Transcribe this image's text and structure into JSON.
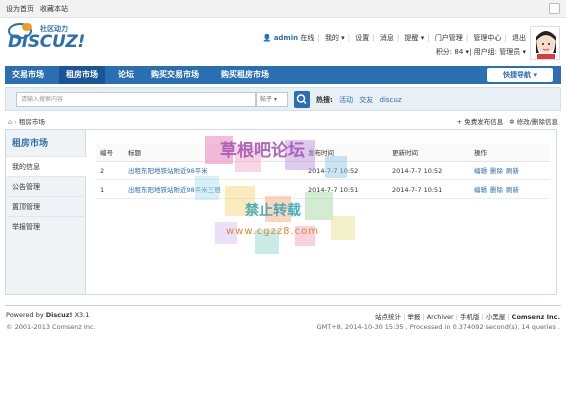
{
  "topbar": {
    "set_home": "设为首页",
    "bookmark": "收藏本站"
  },
  "header": {
    "logo_text": "DISCUZ!",
    "logo_sub": "社区动力",
    "username": "admin",
    "online": "在线",
    "menu": [
      "我的",
      "设置",
      "消息",
      "提醒",
      "门户管理",
      "管理中心",
      "退出"
    ],
    "points": "积分: 84",
    "usergroup": "用户组: 管理员"
  },
  "nav": {
    "items": [
      "交易市场",
      "租房市场",
      "论坛",
      "购买交易市场",
      "购买租房市场"
    ],
    "active_index": 1,
    "quick_nav": "快捷导航"
  },
  "search": {
    "placeholder": "请输入搜索内容",
    "scope": "帖子",
    "hot_label": "热搜:",
    "hot_terms": [
      "活动",
      "交友",
      "discuz"
    ]
  },
  "breadcrumb": {
    "current": "租房市场",
    "action_post": "免费发布信息",
    "action_edit": "修改/删除信息"
  },
  "sidebar": {
    "title": "租房市场",
    "items": [
      "我的信息",
      "公告管理",
      "置顶管理",
      "举报管理"
    ],
    "active_index": 0
  },
  "table": {
    "headers": [
      "编号",
      "标题",
      "发布时间",
      "更新时间",
      "操作"
    ],
    "rows": [
      {
        "id": "2",
        "title": "出租东阳地铁站附近98平米",
        "published": "2014-7-7 10:52",
        "updated": "2014-7-7 10:52",
        "ops": [
          "编辑",
          "删除",
          "刷新"
        ]
      },
      {
        "id": "1",
        "title": "出租东阳地铁站附近98平米三居",
        "published": "2014-7-7 10:51",
        "updated": "2014-7-7 10:51",
        "ops": [
          "编辑",
          "删除",
          "刷新"
        ]
      }
    ]
  },
  "footer": {
    "powered_prefix": "Powered by",
    "powered_brand": "Discuz!",
    "powered_version": "X3.1",
    "copyright": "© 2001-2013 Comsenz Inc.",
    "links": [
      "站点统计",
      "举报",
      "Archiver",
      "手机版",
      "小黑屋"
    ],
    "company": "Comsenz Inc.",
    "stats": "GMT+8, 2014-10-30 15:35 , Processed in 0.374092 second(s), 14 queries ."
  },
  "watermark": {
    "title": "草根吧论坛",
    "subtitle": "禁止转载",
    "url": "www.cgzz8.com"
  },
  "colors": {
    "accent": "#2b6fb3",
    "nav_active": "#1a5596"
  }
}
